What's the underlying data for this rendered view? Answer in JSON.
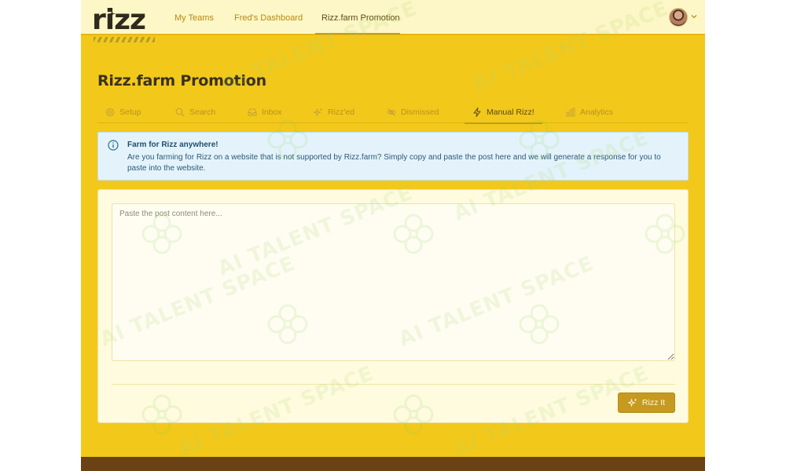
{
  "brand": {
    "logo_text": "rizz"
  },
  "nav": {
    "links": [
      {
        "label": "My Teams"
      },
      {
        "label": "Fred's Dashboard"
      },
      {
        "label": "Rizz.farm Promotion"
      }
    ],
    "active_index": 2
  },
  "page": {
    "title": "Rizz.farm Promotion"
  },
  "tabs": [
    {
      "label": "Setup",
      "icon": "gear-icon"
    },
    {
      "label": "Search",
      "icon": "search-icon"
    },
    {
      "label": "Inbox",
      "icon": "inbox-icon"
    },
    {
      "label": "Rizz'ed",
      "icon": "sparkles-icon"
    },
    {
      "label": "Dismissed",
      "icon": "eye-off-icon"
    },
    {
      "label": "Manual Rizz!",
      "icon": "bolt-icon",
      "active": true
    },
    {
      "label": "Analytics",
      "icon": "bar-chart-icon"
    }
  ],
  "alert": {
    "icon": "info-icon",
    "title": "Farm for Rizz anywhere!",
    "body": "Are you farming for Rizz on a website that is not supported by Rizz.farm? Simply copy and paste the post here and we will generate a response for you to paste into the website."
  },
  "form": {
    "post_input": {
      "value": "",
      "placeholder": "Paste the post content here..."
    },
    "submit_label": "Rizz It"
  },
  "watermark": {
    "text": "AI TALENT SPACE"
  },
  "colors": {
    "app_background": "#f2c81b",
    "nav_background": "#fdf6c6",
    "accent": "#c69a1e",
    "alert_background": "#e4f3fb",
    "card_background": "#fffbdf",
    "footer": "#6b4216"
  }
}
